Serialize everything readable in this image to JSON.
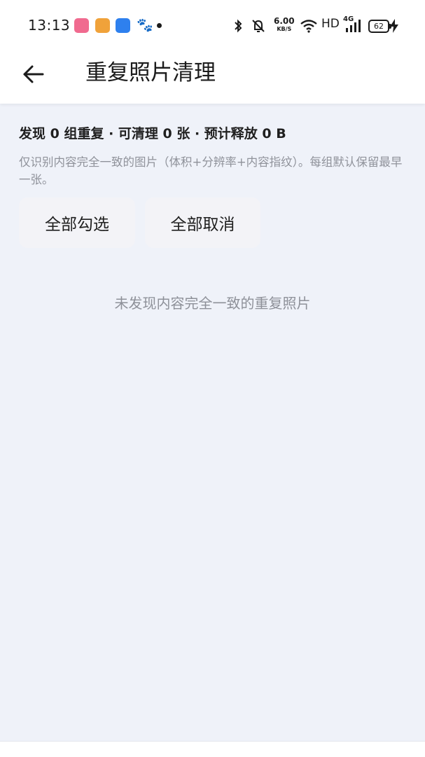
{
  "status_bar": {
    "time": "13:13",
    "notification_icons": [
      "xiaohongshu-app-icon",
      "video-app-icon",
      "chat-app-icon",
      "baidu-paw-icon"
    ],
    "network_speed": "6.00",
    "network_speed_unit": "KB/S",
    "hd_label": "HD",
    "network_type": "4G",
    "battery_level": "62"
  },
  "app_bar": {
    "title": "重复照片清理"
  },
  "main": {
    "summary": "发现 0 组重复 · 可清理 0 张 · 预计释放 0 B",
    "hint": "仅识别内容完全一致的图片（体积+分辨率+内容指纹）。每组默认保留最早一张。",
    "select_all_label": "全部勾选",
    "deselect_all_label": "全部取消",
    "empty_message": "未发现内容完全一致的重复照片"
  },
  "colors": {
    "background": "#eff2f9",
    "surface": "#ffffff",
    "button_bg": "#f3f3f7",
    "hint_text": "#8f929a"
  }
}
